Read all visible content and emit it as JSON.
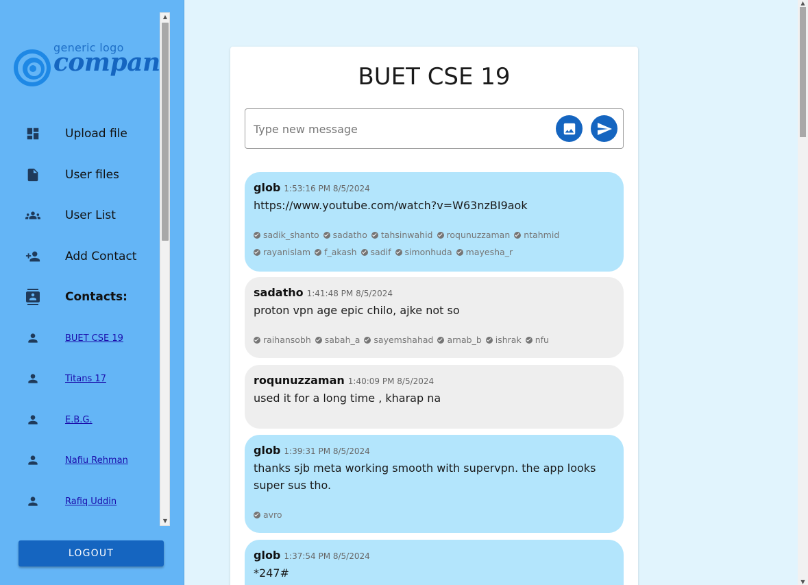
{
  "logo": {
    "small": "generic logo",
    "big": "company"
  },
  "sidebar": {
    "nav": [
      {
        "label": "Upload file",
        "icon": "dashboard-icon"
      },
      {
        "label": "User files",
        "icon": "file-icon"
      },
      {
        "label": "User List",
        "icon": "group-icon"
      },
      {
        "label": "Add Contact",
        "icon": "person-add-icon"
      },
      {
        "label": "Contacts:",
        "icon": "contacts-icon"
      }
    ],
    "contacts": [
      "BUET CSE 19",
      "Titans 17",
      "E.B.G.",
      "Nafiu Rehman",
      "Rafiq Uddin"
    ],
    "logout_label": "LOGOUT"
  },
  "chat": {
    "title": "BUET CSE 19",
    "input_placeholder": "Type new message",
    "messages": [
      {
        "author": "glob",
        "time": "1:53:16 PM 8/5/2024",
        "text": "https://www.youtube.com/watch?v=W63nzBI9aok",
        "style": "blue",
        "seen_by": [
          "sadik_shanto",
          "sadatho",
          "tahsinwahid",
          "roqunuzzaman",
          "ntahmid",
          "rayanislam",
          "f_akash",
          "sadif",
          "simonhuda",
          "mayesha_r"
        ]
      },
      {
        "author": "sadatho",
        "time": "1:41:48 PM 8/5/2024",
        "text": "proton vpn age epic chilo, ajke not so",
        "style": "gray",
        "seen_by": [
          "raihansobh",
          "sabah_a",
          "sayemshahad",
          "arnab_b",
          "ishrak",
          "nfu"
        ]
      },
      {
        "author": "roqunuzzaman",
        "time": "1:40:09 PM 8/5/2024",
        "text": "used it for a long time , kharap na",
        "style": "gray",
        "seen_by": []
      },
      {
        "author": "glob",
        "time": "1:39:31 PM 8/5/2024",
        "text": "thanks sjb meta working smooth with supervpn. the app looks super sus tho.",
        "style": "blue",
        "seen_by": [
          "avro"
        ]
      },
      {
        "author": "glob",
        "time": "1:37:54 PM 8/5/2024",
        "text": "*247#",
        "style": "blue",
        "seen_by": []
      }
    ]
  },
  "colors": {
    "sidebar": "#64b5f6",
    "accent": "#1565c0",
    "bubble_blue": "#b3e5fc",
    "bubble_gray": "#eeeeee",
    "page_bg": "#e1f4fd"
  }
}
